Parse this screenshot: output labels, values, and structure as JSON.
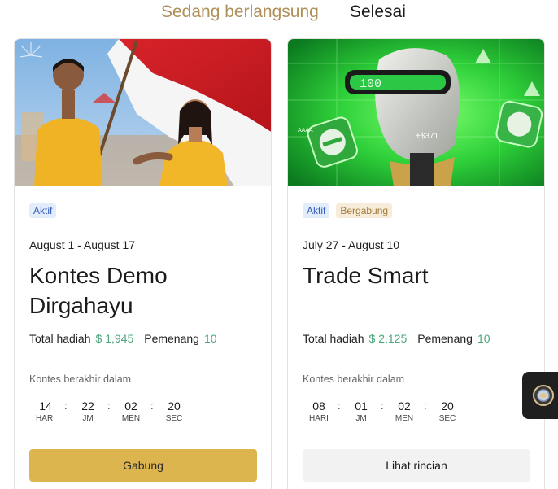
{
  "tabs": {
    "ongoing": "Sedang berlangsung",
    "finished": "Selesai"
  },
  "labels": {
    "total_prize": "Total hadiah",
    "winners": "Pemenang",
    "ends_in": "Kontes berakhir dalam",
    "days": "HARI",
    "hours": "JM",
    "minutes": "MEN",
    "seconds": "SEC"
  },
  "contests": [
    {
      "badges": [
        "Aktif"
      ],
      "dates": "August 1 - August 17",
      "title": "Kontes Demo Dirgahayu",
      "prize": "$ 1,945",
      "winners": "10",
      "countdown": {
        "days": "14",
        "hours": "22",
        "minutes": "02",
        "seconds": "20"
      },
      "button": "Gabung",
      "banner_theme": "indonesian-flag-celebration"
    },
    {
      "badges": [
        "Aktif",
        "Bergabung"
      ],
      "dates": "July 27 - August 10",
      "title": "Trade Smart",
      "prize": "$ 2,125",
      "winners": "10",
      "countdown": {
        "days": "08",
        "hours": "01",
        "minutes": "02",
        "seconds": "20"
      },
      "button": "Lihat rincian",
      "banner_theme": "green-robot-trading",
      "banner_text": {
        "visor": "100",
        "chip": "+$371",
        "small": "AAAA"
      }
    }
  ],
  "colors": {
    "accent_tab": "#b0905a",
    "prize_green": "#4aa77a",
    "join_button": "#ddb54e",
    "badge_active_bg": "#e3ecfb",
    "badge_joined_bg": "#f7ecd9"
  },
  "floating_button": {
    "icon": "gift-coin-icon"
  }
}
